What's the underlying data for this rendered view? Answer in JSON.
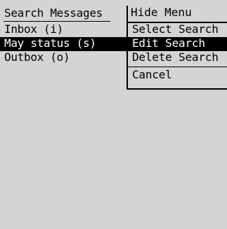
{
  "screen_title": "Search Messages",
  "list": {
    "items": [
      {
        "label": "Inbox (i)",
        "selected": false
      },
      {
        "label": "May status (s)",
        "selected": true
      },
      {
        "label": "Outbox (o)",
        "selected": false
      }
    ]
  },
  "menu": {
    "header": "Hide Menu",
    "items": [
      {
        "label": "Select Search",
        "selected": false
      },
      {
        "label": "Edit Search",
        "selected": true
      },
      {
        "label": "Delete Search",
        "selected": false
      }
    ],
    "cancel": "Cancel"
  },
  "colors": {
    "background": "#d4d4d4",
    "text": "#000000",
    "selection_bg": "#000000",
    "selection_text": "#ffffff"
  }
}
